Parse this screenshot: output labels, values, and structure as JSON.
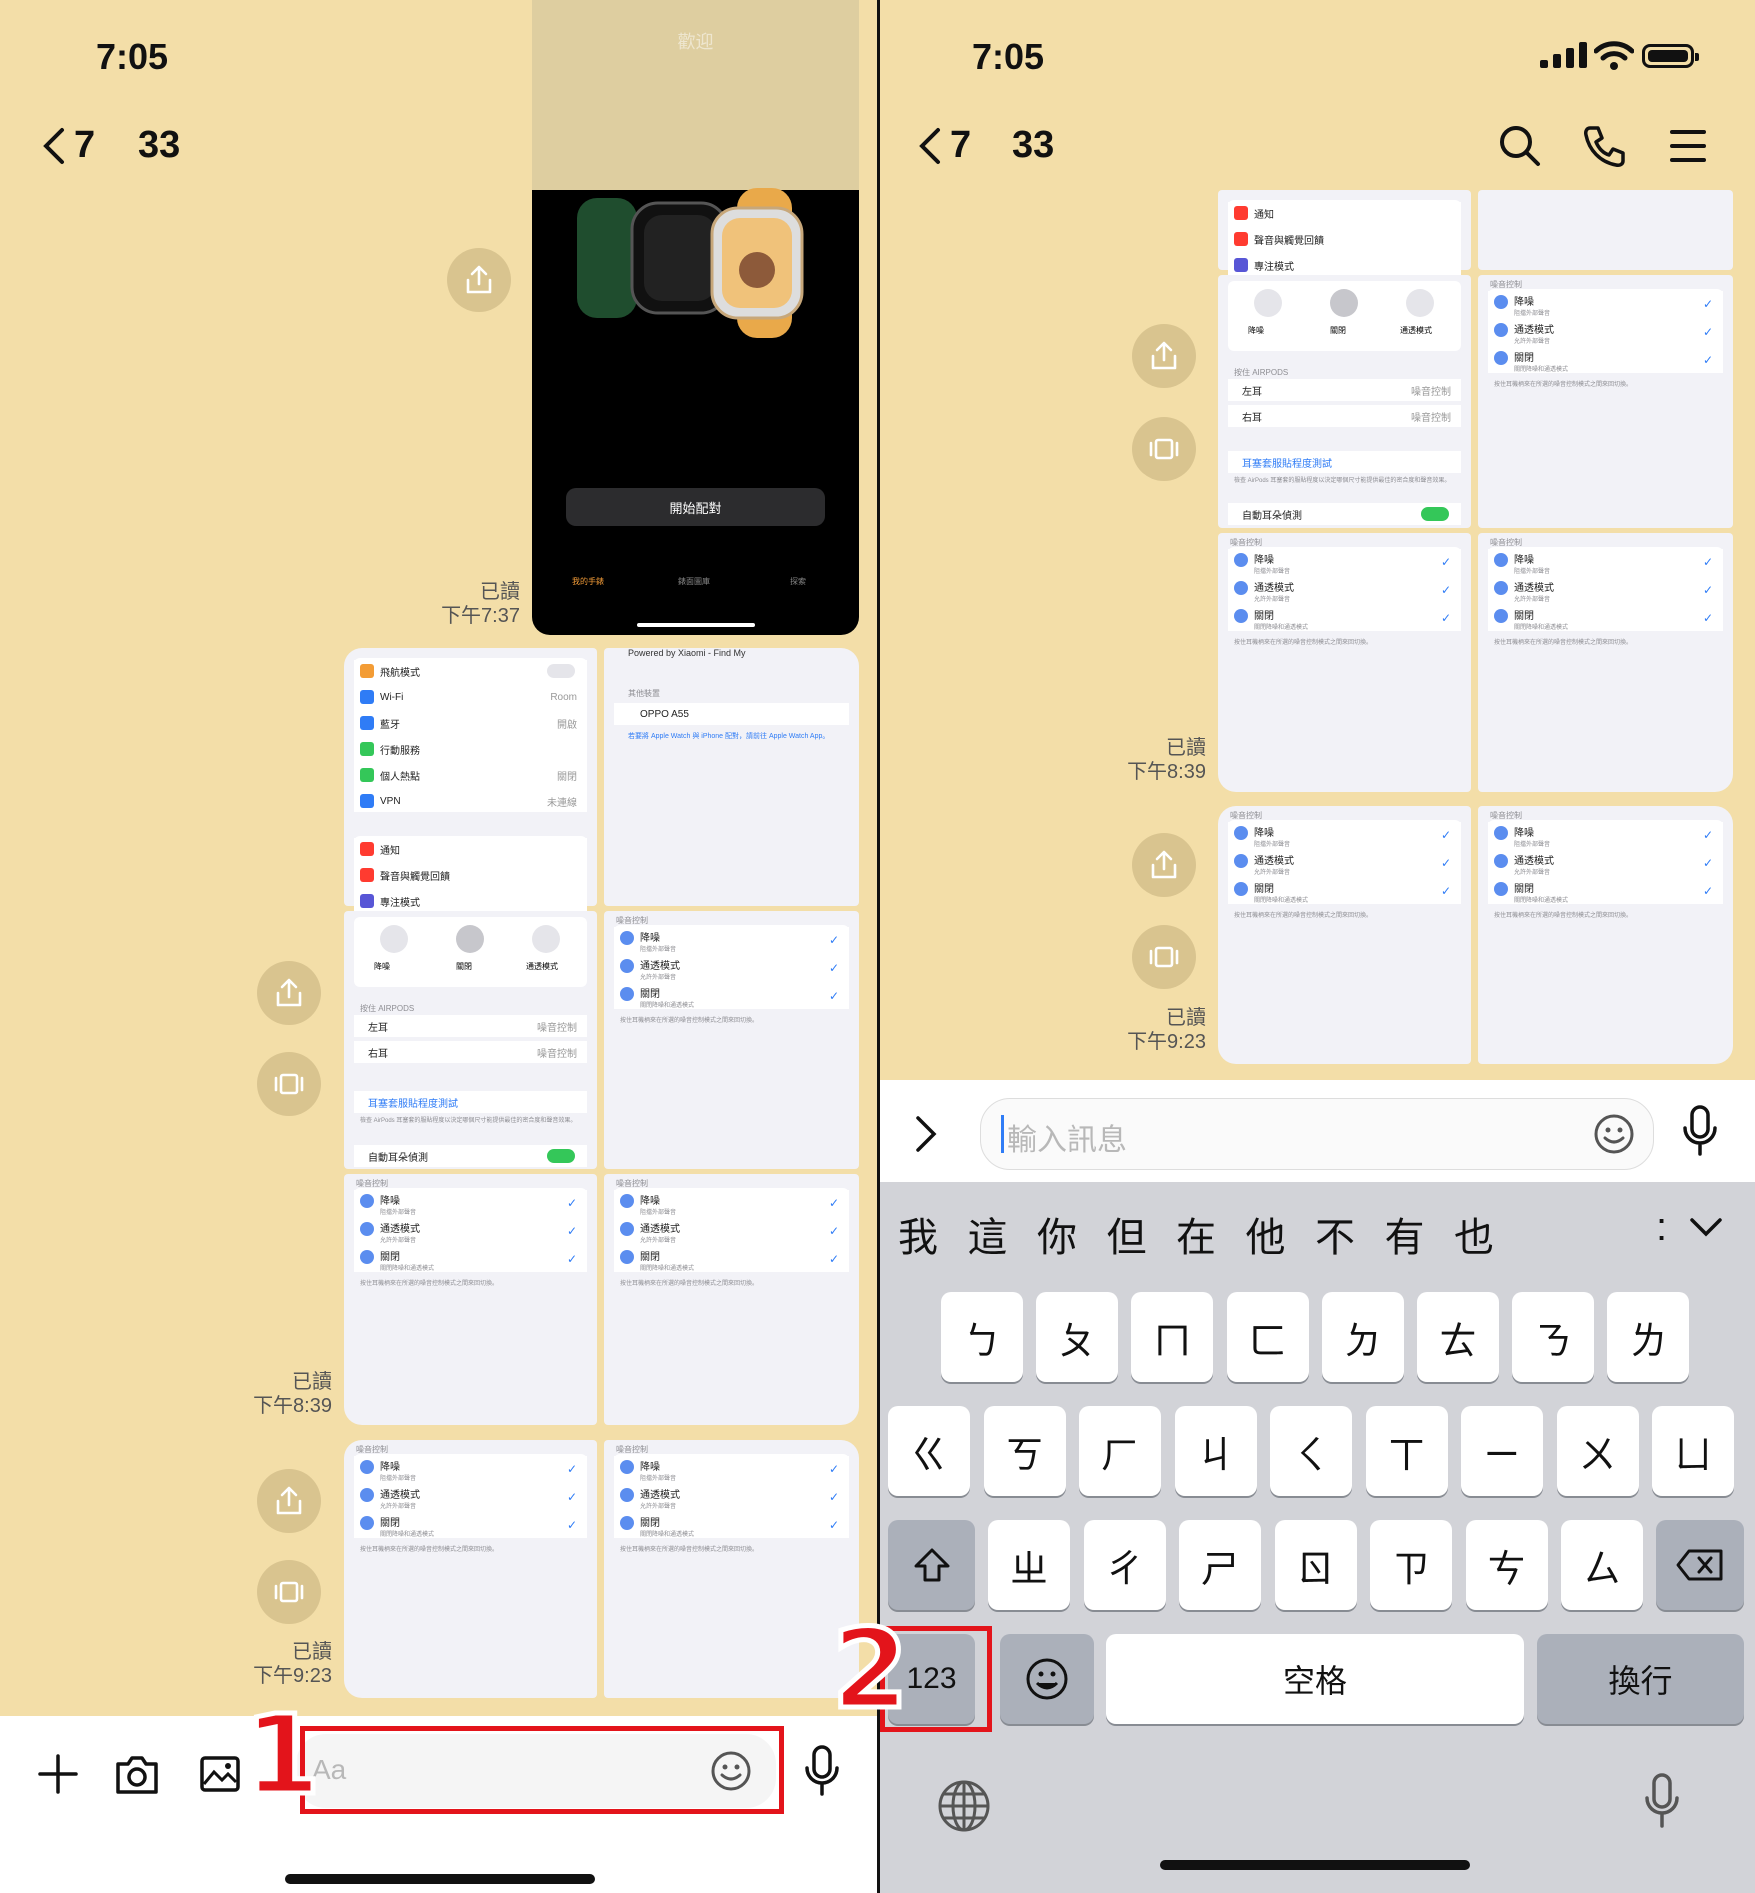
{
  "status": {
    "time": "7:05"
  },
  "chat": {
    "back_count": "7",
    "member_count": "33"
  },
  "left": {
    "watch_screen": {
      "pair_button": "開始配對",
      "tabs": [
        "我的手錶",
        "錶面圖庫",
        "探索"
      ],
      "top_text": "歡迎"
    },
    "read_label": "已讀",
    "msg1_time": "下午7:37",
    "msg2_time": "下午8:39",
    "msg3_time": "下午9:23",
    "settings_items": [
      {
        "label": "飛航模式",
        "value": ""
      },
      {
        "label": "Wi-Fi",
        "value": "Room"
      },
      {
        "label": "藍牙",
        "value": "開啟"
      },
      {
        "label": "行動服務",
        "value": ""
      },
      {
        "label": "個人熱點",
        "value": "關閉"
      },
      {
        "label": "VPN",
        "value": "未連線"
      }
    ],
    "settings_items2": [
      {
        "label": "通知"
      },
      {
        "label": "聲音與觸覺回饋"
      },
      {
        "label": "專注模式"
      }
    ],
    "findmy": {
      "title": "Powered by Xiaomi - Find My",
      "section": "其他裝置",
      "device": "OPPO A55",
      "note": "若要將 Apple Watch 與 iPhone 配對，請前往 Apple Watch App。"
    },
    "airpods": {
      "modes": [
        "降噪",
        "關閉",
        "通透模式"
      ],
      "press_header": "按住 AIRPODS",
      "left_ear": "左耳",
      "right_ear": "右耳",
      "ear_value": "噪音控制",
      "fit_test": "耳塞套服貼程度測試",
      "fit_note": "檢查 AirPods 耳塞套的服貼程度以決定哪個尺寸能提供最佳的密合度和聲音效果。",
      "auto_detect": "自動耳朵偵測"
    },
    "noise": {
      "header": "噪音控制",
      "items": [
        {
          "label": "降噪",
          "sub": "阻擋外部聲音"
        },
        {
          "label": "通透模式",
          "sub": "允許外部聲音"
        },
        {
          "label": "關閉",
          "sub": "關閉降噪和通透模式"
        }
      ],
      "note": "按住耳機柄來在所選的噪音控制模式之間來回切換。"
    },
    "input_placeholder": "Aa"
  },
  "right": {
    "input_placeholder": "輸入訊息",
    "candidates": [
      "我",
      "這",
      "你",
      "但",
      "在",
      "他",
      "不",
      "有",
      "也"
    ],
    "row1": [
      "ㄅ",
      "ㄆ",
      "ㄇ",
      "ㄈ",
      "ㄉ",
      "ㄊ",
      "ㄋ",
      "ㄌ"
    ],
    "row2": [
      "ㄍ",
      "ㄎ",
      "ㄏ",
      "ㄐ",
      "ㄑ",
      "ㄒ",
      "ㄧ",
      "ㄨ",
      "ㄩ"
    ],
    "row3": [
      "ㄓ",
      "ㄔ",
      "ㄕ",
      "ㄖ",
      "ㄗ",
      "ㄘ",
      "ㄙ"
    ],
    "key_123": "123",
    "key_space": "空格",
    "key_return": "換行"
  },
  "annotations": {
    "step1": "1",
    "step2": "2"
  },
  "colors": {
    "chat_bg": "#f3dea8",
    "highlight": "#e3141b",
    "toggle_on": "#34c759",
    "link_blue": "#2f7cf6"
  }
}
